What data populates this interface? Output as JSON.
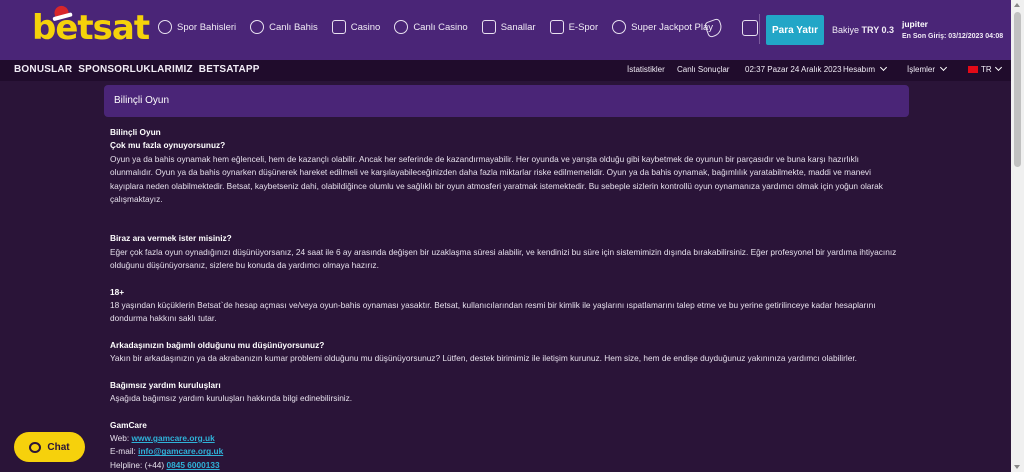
{
  "header": {
    "logo": "betsat",
    "nav": [
      {
        "label": "Spor Bahisleri",
        "icon": "soccer-ball-icon"
      },
      {
        "label": "Canlı Bahis",
        "icon": "live-player-icon"
      },
      {
        "label": "Casino",
        "icon": "slot-machine-icon"
      },
      {
        "label": "Canlı Casino",
        "icon": "chips-icon"
      },
      {
        "label": "Sanallar",
        "icon": "virtual-horse-icon"
      },
      {
        "label": "E-Spor",
        "icon": "gamepad-icon"
      },
      {
        "label": "Super Jackpot Play",
        "icon": "jackpot-icon"
      }
    ],
    "deposit_label": "Para Yatır",
    "balance_label": "Bakiye",
    "balance_value": "TRY 0.3",
    "username": "jupiter",
    "last_login": "En Son Giriş: 03/12/2023 04:08"
  },
  "subbar": {
    "links": [
      "BONUSLAR",
      "SPONSORLUKLARIMIZ",
      "BETSATAPP"
    ],
    "statistics": "İstatistikler",
    "live_results": "Canlı Sonuçlar",
    "datetime": "02:37 Pazar 24 Aralık 2023",
    "account": "Hesabım",
    "transactions": "İşlemler",
    "language": "TR"
  },
  "panel": {
    "title": "Bilinçli Oyun"
  },
  "content": {
    "heading": "Bilinçli Oyun",
    "q1": "Çok mu fazla oynuyorsunuz?",
    "p1": "Oyun ya da bahis oynamak hem eğlenceli, hem de kazançlı olabilir. Ancak her seferinde de kazandırmayabilir. Her oyunda ve yarışta olduğu gibi kaybetmek de oyunun bir parçasıdır ve buna karşı hazırlıklı olunmalıdır. Oyun ya da bahis oynarken düşünerek hareket edilmeli ve karşılayabileceğinizden daha fazla miktarlar riske edilmemelidir. Oyun ya da bahis oynamak, bağımlılık yaratabilmekte, maddi ve manevi kayıplara neden olabilmektedir. Betsat, kaybetseniz dahi, olabildiğince olumlu ve sağlıklı bir oyun atmosferi yaratmak istemektedir. Bu sebeple sizlerin kontrollü oyun oynamanıza yardımcı olmak için yoğun olarak çalışmaktayız.",
    "q2": "Biraz ara vermek ister misiniz?",
    "p2": "Eğer çok fazla oyun oynadığınızı düşünüyorsanız, 24 saat ile 6 ay arasında değişen bir uzaklaşma süresi alabilir, ve kendinizi bu süre için sistemimizin dışında bırakabilirsiniz. Eğer profesyonel bir yardıma ihtiyacınız olduğunu düşünüyorsanız, sizlere bu konuda da yardımcı olmaya hazırız.",
    "q3": "18+",
    "p3": "18 yaşından küçüklerin Betsat`de hesap açması ve/veya oyun-bahis oynaması yasaktır. Betsat, kullanıcılarından resmi bir kimlik ile yaşlarını ıspatlamarını talep etme ve bu yerine getirilinceye kadar hesaplarını dondurma hakkını saklı tutar.",
    "q4": "Arkadaşınızın bağımlı olduğunu mu düşünüyorsunuz?",
    "p4": "Yakın bir arkadaşınızın ya da akrabanızın kumar problemi olduğunu mu düşünüyorsunuz? Lütfen, destek birimimiz ile iletişim kurunuz. Hem size, hem de endişe duyduğunuz yakınınıza yardımcı olabilirler.",
    "q5": "Bağımsız yardım kuruluşları",
    "p5": "Aşağıda bağımsız yardım kuruluşları hakkında bilgi edinebilirsiniz.",
    "org_name": "GamCare",
    "web_label": "Web:",
    "web_value": "www.gamcare.org.uk",
    "email_label": "E-mail:",
    "email_value": "info@gamcare.org.uk",
    "helpline_label": "Helpline: (+44)",
    "helpline_value": "0845 6000133"
  },
  "chat": {
    "label": "Chat"
  }
}
